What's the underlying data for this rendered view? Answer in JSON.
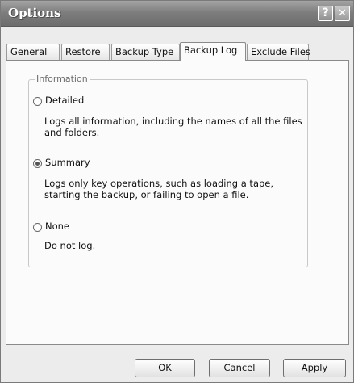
{
  "window": {
    "title": "Options",
    "help_glyph": "?",
    "close_glyph": "✕"
  },
  "tabs": [
    {
      "label": "General"
    },
    {
      "label": "Restore"
    },
    {
      "label": "Backup Type"
    },
    {
      "label": "Backup Log",
      "active": true
    },
    {
      "label": "Exclude Files"
    }
  ],
  "information": {
    "group_label": "Information",
    "options": [
      {
        "label": "Detailed",
        "description": "Logs all information, including the names of all the files and folders.",
        "checked": false
      },
      {
        "label": "Summary",
        "description": "Logs only key operations, such as loading a tape, starting the backup, or failing to open a file.",
        "checked": true
      },
      {
        "label": "None",
        "description": "Do not log.",
        "checked": false
      }
    ]
  },
  "buttons": {
    "ok": "OK",
    "cancel": "Cancel",
    "apply": "Apply"
  }
}
